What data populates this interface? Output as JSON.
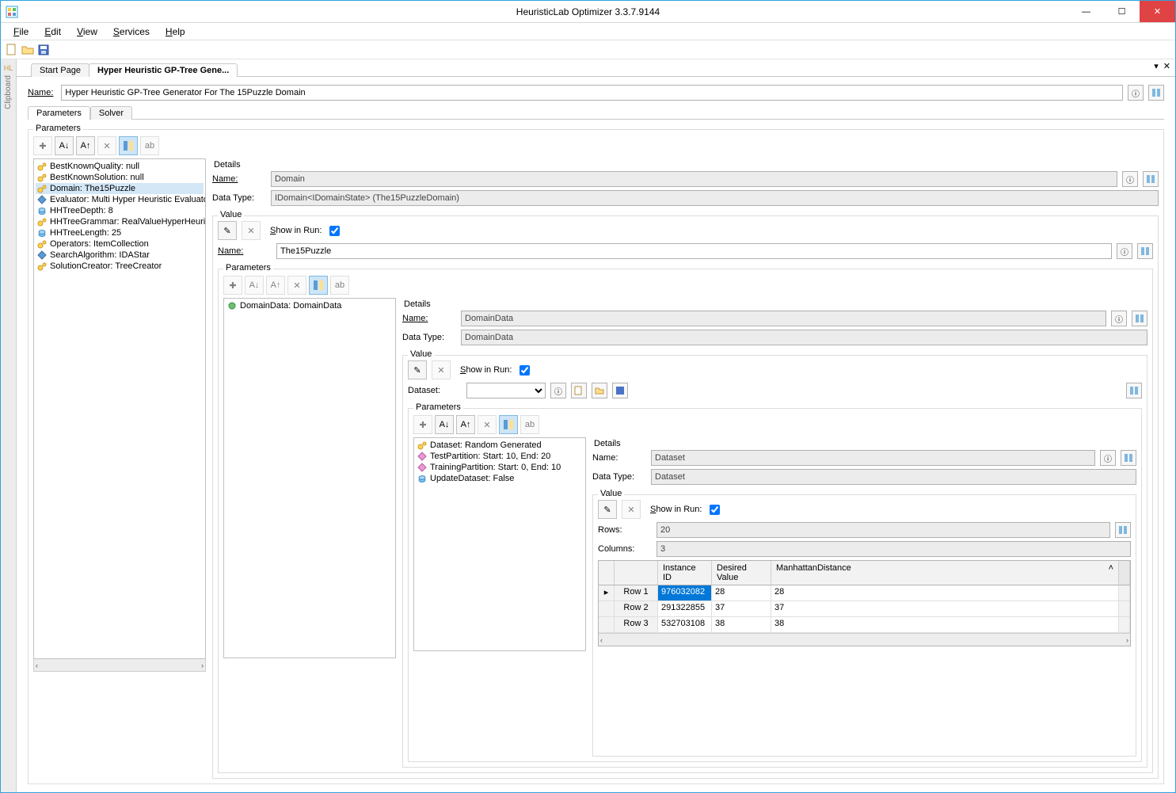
{
  "window": {
    "title": "HeuristicLab Optimizer 3.3.7.9144"
  },
  "menu": {
    "file": "File",
    "edit": "Edit",
    "view": "View",
    "services": "Services",
    "help": "Help"
  },
  "clipboard": {
    "label": "Clipboard"
  },
  "tabs": {
    "start": "Start Page",
    "main": "Hyper Heuristic GP-Tree Gene..."
  },
  "top_name": {
    "label": "Name:",
    "value": "Hyper Heuristic GP-Tree Generator For The 15Puzzle Domain"
  },
  "subtabs": {
    "parameters": "Parameters",
    "solver": "Solver"
  },
  "left_params_legend": "Parameters",
  "left_params": [
    "BestKnownQuality: null",
    "BestKnownSolution: null",
    "Domain: The15Puzzle",
    "Evaluator: Multi Hyper Heuristic Evaluator",
    "HHTreeDepth: 8",
    "HHTreeGrammar: RealValueHyperHeuristicGrammar",
    "HHTreeLength: 25",
    "Operators: ItemCollection<Item>",
    "SearchAlgorithm: IDAStar",
    "SolutionCreator: TreeCreator"
  ],
  "left_selected_index": 2,
  "details": {
    "title": "Details",
    "name_label": "Name:",
    "datatype_label": "Data Type:",
    "value_label": "Value",
    "showinrun_label": "Show in Run:"
  },
  "d1": {
    "name": "Domain",
    "datatype": "IDomain<IDomainState> (The15PuzzleDomain)",
    "name2": "The15Puzzle",
    "params_legend": "Parameters",
    "param_item": "DomainData: DomainData"
  },
  "d2": {
    "name": "DomainData",
    "datatype": "DomainData",
    "dataset_label": "Dataset:",
    "params_legend": "Parameters",
    "items": [
      "Dataset: Random Generated",
      "TestPartition: Start: 10, End: 20",
      "TrainingPartition: Start: 0, End: 10",
      "UpdateDataset: False"
    ]
  },
  "d3": {
    "name": "Dataset",
    "datatype": "Dataset",
    "rows_label": "Rows:",
    "rows": "20",
    "cols_label": "Columns:",
    "cols": "3",
    "headers": [
      "",
      "Instance ID",
      "Desired Value",
      "ManhattanDistance"
    ],
    "rows_data": [
      {
        "label": "Row 1",
        "id": "976032082",
        "dv": "28",
        "md": "28"
      },
      {
        "label": "Row 2",
        "id": "291322855",
        "dv": "37",
        "md": "37"
      },
      {
        "label": "Row 3",
        "id": "532703108",
        "dv": "38",
        "md": "38"
      }
    ]
  }
}
